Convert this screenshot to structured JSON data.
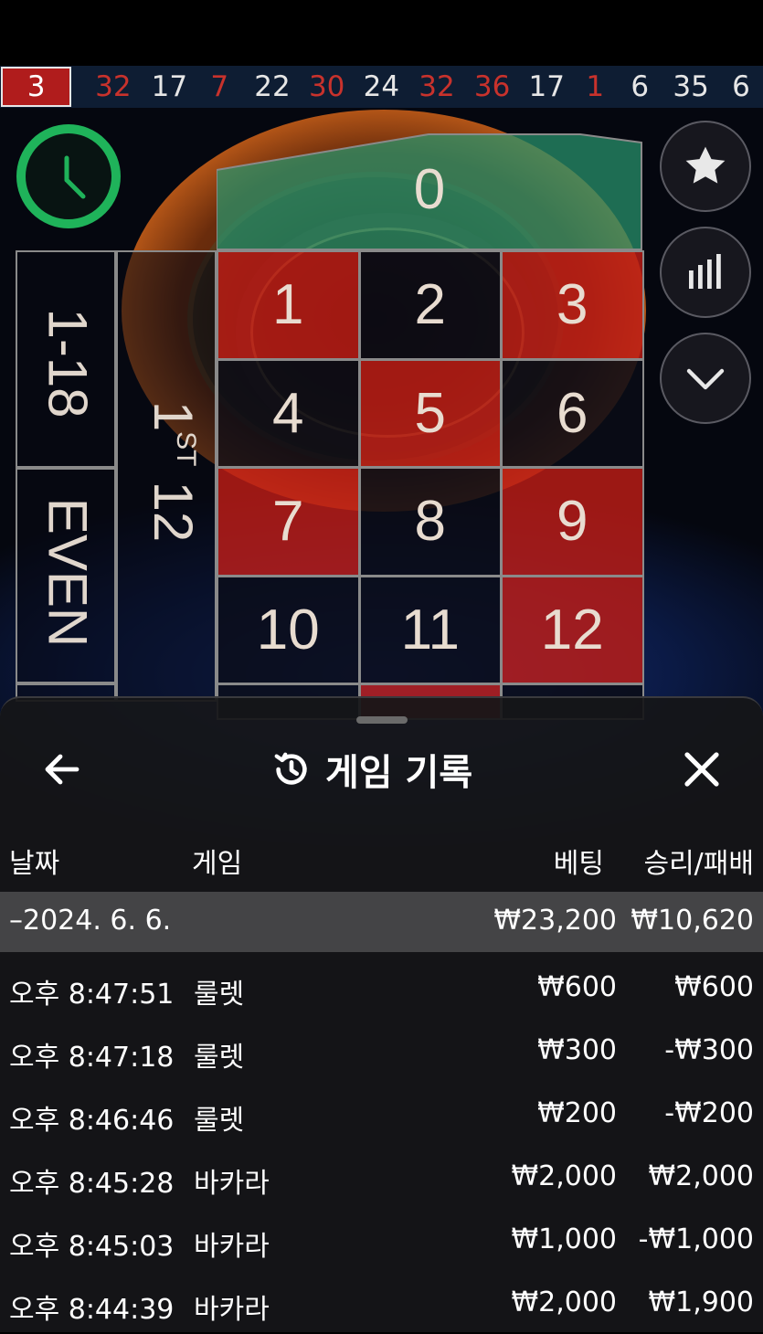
{
  "recent_results": [
    {
      "n": "3",
      "color": "#ffffff",
      "current": true
    },
    {
      "n": "32",
      "color": "#c8322c"
    },
    {
      "n": "17",
      "color": "#e6e6e6"
    },
    {
      "n": "7",
      "color": "#c8322c"
    },
    {
      "n": "22",
      "color": "#e6e6e6"
    },
    {
      "n": "30",
      "color": "#c8322c"
    },
    {
      "n": "24",
      "color": "#e6e6e6"
    },
    {
      "n": "32",
      "color": "#c8322c"
    },
    {
      "n": "36",
      "color": "#c8322c"
    },
    {
      "n": "17",
      "color": "#e6e6e6"
    },
    {
      "n": "1",
      "color": "#c8322c"
    },
    {
      "n": "6",
      "color": "#e6e6e6"
    },
    {
      "n": "35",
      "color": "#e6e6e6"
    },
    {
      "n": "6",
      "color": "#e6e6e6"
    }
  ],
  "table": {
    "zero": "0",
    "numbers": [
      {
        "n": "1",
        "color": "red"
      },
      {
        "n": "2",
        "color": "black"
      },
      {
        "n": "3",
        "color": "red"
      },
      {
        "n": "4",
        "color": "black"
      },
      {
        "n": "5",
        "color": "red"
      },
      {
        "n": "6",
        "color": "black"
      },
      {
        "n": "7",
        "color": "red"
      },
      {
        "n": "8",
        "color": "black"
      },
      {
        "n": "9",
        "color": "red"
      },
      {
        "n": "10",
        "color": "black"
      },
      {
        "n": "11",
        "color": "black"
      },
      {
        "n": "12",
        "color": "red"
      }
    ],
    "low_label": "1-18",
    "even_label": "EVEN",
    "dozen_label": "1ST 12",
    "dozen_num": "1",
    "dozen_sup": "ST",
    "dozen_12": "12"
  },
  "history": {
    "title": "게임 기록",
    "columns": {
      "date": "날짜",
      "game": "게임",
      "bet": "베팅",
      "winloss": "승리/패배"
    },
    "date_group": {
      "date": "–2024. 6. 6.",
      "bet": "₩23,200",
      "winloss": "₩10,620"
    },
    "rows": [
      {
        "time": "오후 8:47:51",
        "game": "룰렛",
        "bet": "₩600",
        "winloss": "₩600"
      },
      {
        "time": "오후 8:47:18",
        "game": "룰렛",
        "bet": "₩300",
        "winloss": "-₩300"
      },
      {
        "time": "오후 8:46:46",
        "game": "룰렛",
        "bet": "₩200",
        "winloss": "-₩200"
      },
      {
        "time": "오후 8:45:28",
        "game": "바카라",
        "bet": "₩2,000",
        "winloss": "₩2,000"
      },
      {
        "time": "오후 8:45:03",
        "game": "바카라",
        "bet": "₩1,000",
        "winloss": "-₩1,000"
      },
      {
        "time": "오후 8:44:39",
        "game": "바카라",
        "bet": "₩2,000",
        "winloss": "₩1,900"
      }
    ]
  },
  "icons": {
    "timer": "clock-icon",
    "favorite": "star-icon",
    "stats": "bar-chart-icon",
    "collapse": "chevron-down-icon",
    "back": "arrow-left-icon",
    "history": "history-icon",
    "close": "close-icon"
  },
  "colors": {
    "timer_green": "#1fb35a",
    "red": "#be1c16",
    "strip_red": "#b01c1c"
  }
}
